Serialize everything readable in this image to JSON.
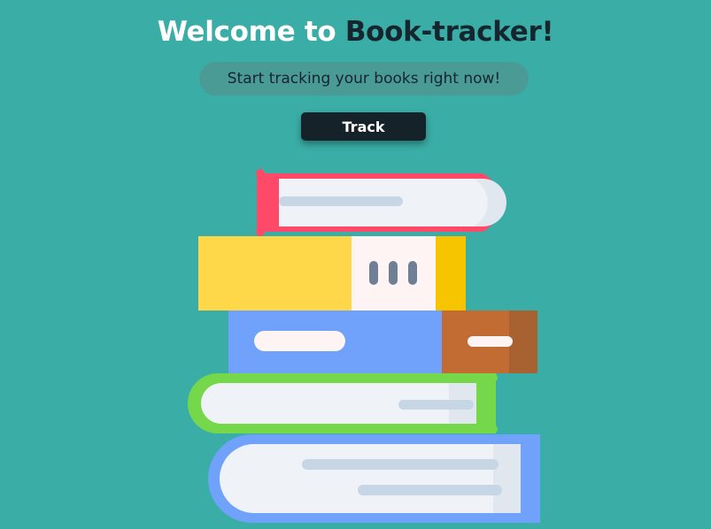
{
  "header": {
    "title_prefix": "Welcome to ",
    "title_brand": "Book-tracker!",
    "tagline": "Start tracking your books right now!"
  },
  "actions": {
    "track_label": "Track"
  },
  "illustration": {
    "name": "book-stack",
    "colors": {
      "red_cover": "#fe4a68",
      "yellow_cover": "#ffd84a",
      "blue_cover": "#70a2fb",
      "brown_cover": "#c26b32",
      "green_cover": "#74d84a",
      "pages": "#eff3f7",
      "line": "#c7d6e4"
    }
  }
}
